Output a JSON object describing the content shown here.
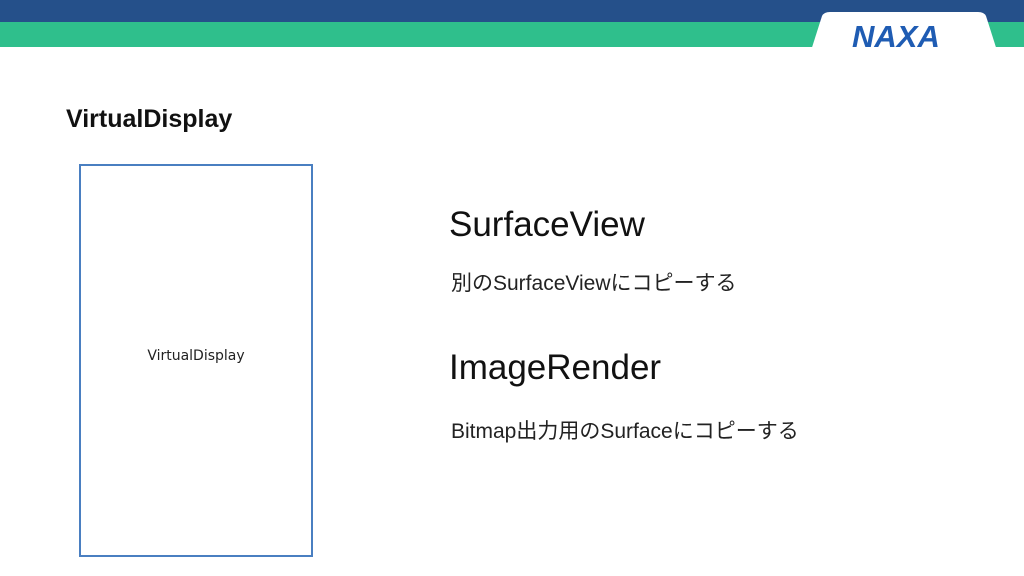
{
  "header": {
    "logo_text": "NAXA",
    "colors": {
      "navy": "#25508a",
      "green": "#2fbf8c",
      "logo": "#1f5cb3"
    }
  },
  "slide": {
    "title": "VirtualDisplay",
    "box_label": "VirtualDisplay",
    "items": [
      {
        "heading": "SurfaceView",
        "description": "別のSurfaceViewにコピーする"
      },
      {
        "heading": "ImageRender",
        "description": "Bitmap出力用のSurfaceにコピーする"
      }
    ]
  }
}
